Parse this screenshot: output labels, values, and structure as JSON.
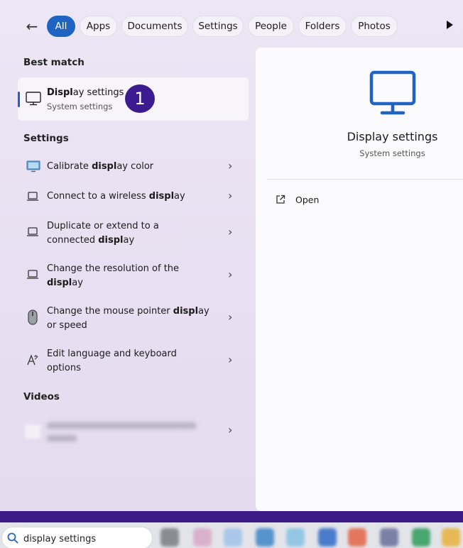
{
  "filters": {
    "back": "←",
    "chips": [
      "All",
      "Apps",
      "Documents",
      "Settings",
      "People",
      "Folders",
      "Photos"
    ],
    "active": "All"
  },
  "sections": {
    "best_match": "Best match",
    "settings": "Settings",
    "videos": "Videos"
  },
  "best_match": {
    "title": "Display settings",
    "subtitle": "System settings",
    "step_badge": "1"
  },
  "settings_items": [
    {
      "line1": "Calibrate display color",
      "line2": ""
    },
    {
      "line1": "Connect to a wireless display",
      "line2": ""
    },
    {
      "line1": "Duplicate or extend to a",
      "line2": "connected display"
    },
    {
      "line1": "Change the resolution of the",
      "line2": "display"
    },
    {
      "line1": "Change the mouse pointer display",
      "line2": "or speed"
    },
    {
      "line1": "Edit language and keyboard",
      "line2": "options"
    }
  ],
  "chevron": "›",
  "right_panel": {
    "title": "Display settings",
    "subtitle": "System settings",
    "open_label": "Open"
  },
  "search": {
    "query": "display settings"
  },
  "colors": {
    "accent": "#1f64c2",
    "badge": "#3c1a8f",
    "bottom_band": "#3b1a88"
  }
}
